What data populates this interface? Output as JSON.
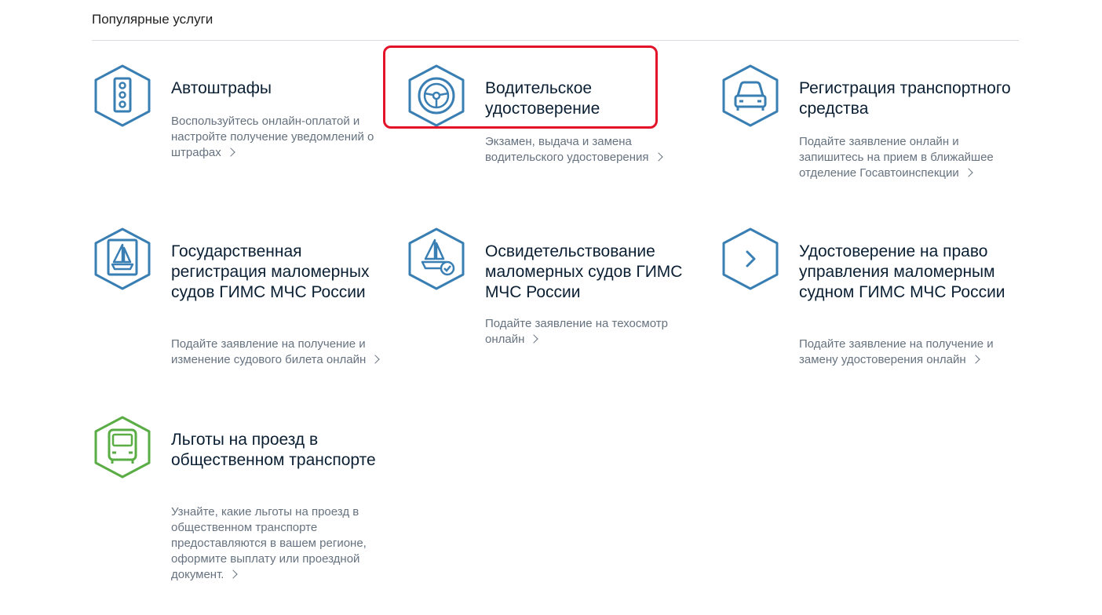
{
  "section": {
    "title": "Популярные услуги"
  },
  "colors": {
    "icon_blue": "#3a7fb3",
    "icon_green": "#5aac45",
    "highlight": "#e3132a"
  },
  "services": [
    {
      "title": "Автоштрафы",
      "desc": "Воспользуйтесь онлайн-оплатой и настройте получение уведомлений о штрафах",
      "icon": "traffic-light-icon"
    },
    {
      "title": "Водительское удостоверение",
      "desc": "Экзамен, выдача и замена водительского удостоверения",
      "icon": "steering-wheel-icon"
    },
    {
      "title": "Регистрация транспортного средства",
      "desc": "Подайте заявление онлайн и запишитесь на прием в ближайшее отделение Госавтоинспекции",
      "icon": "car-icon"
    },
    {
      "title": "Государственная регистрация маломерных судов ГИМС МЧС России",
      "desc": "Подайте заявление на получение и изменение судового билета онлайн",
      "icon": "boat-document-icon"
    },
    {
      "title": "Освидетельствование маломерных судов ГИМС МЧС России",
      "desc": "Подайте заявление на техосмотр онлайн",
      "icon": "boat-check-icon"
    },
    {
      "title": "Удостоверение на право управления маломерным судном ГИМС МЧС России",
      "desc": "Подайте заявление на получение и замену удостоверения онлайн",
      "icon": "chevron-right-icon"
    },
    {
      "title": "Льготы на проезд в общественном транспорте",
      "desc": "Узнайте, какие льготы на проезд в общественном транспорте предоставляются в вашем регионе, оформите выплату или проездной документ.",
      "icon": "bus-icon"
    }
  ]
}
